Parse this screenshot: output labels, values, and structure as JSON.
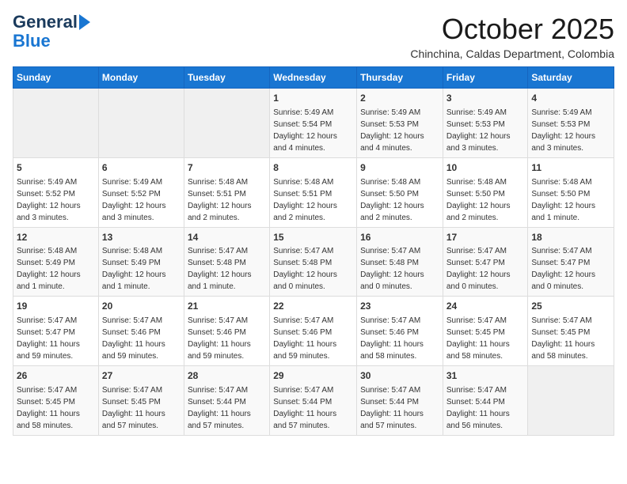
{
  "logo": {
    "line1": "General",
    "line2": "Blue"
  },
  "title": "October 2025",
  "location": "Chinchina, Caldas Department, Colombia",
  "days_of_week": [
    "Sunday",
    "Monday",
    "Tuesday",
    "Wednesday",
    "Thursday",
    "Friday",
    "Saturday"
  ],
  "weeks": [
    [
      {
        "day": "",
        "info": ""
      },
      {
        "day": "",
        "info": ""
      },
      {
        "day": "",
        "info": ""
      },
      {
        "day": "1",
        "info": "Sunrise: 5:49 AM\nSunset: 5:54 PM\nDaylight: 12 hours\nand 4 minutes."
      },
      {
        "day": "2",
        "info": "Sunrise: 5:49 AM\nSunset: 5:53 PM\nDaylight: 12 hours\nand 4 minutes."
      },
      {
        "day": "3",
        "info": "Sunrise: 5:49 AM\nSunset: 5:53 PM\nDaylight: 12 hours\nand 3 minutes."
      },
      {
        "day": "4",
        "info": "Sunrise: 5:49 AM\nSunset: 5:53 PM\nDaylight: 12 hours\nand 3 minutes."
      }
    ],
    [
      {
        "day": "5",
        "info": "Sunrise: 5:49 AM\nSunset: 5:52 PM\nDaylight: 12 hours\nand 3 minutes."
      },
      {
        "day": "6",
        "info": "Sunrise: 5:49 AM\nSunset: 5:52 PM\nDaylight: 12 hours\nand 3 minutes."
      },
      {
        "day": "7",
        "info": "Sunrise: 5:48 AM\nSunset: 5:51 PM\nDaylight: 12 hours\nand 2 minutes."
      },
      {
        "day": "8",
        "info": "Sunrise: 5:48 AM\nSunset: 5:51 PM\nDaylight: 12 hours\nand 2 minutes."
      },
      {
        "day": "9",
        "info": "Sunrise: 5:48 AM\nSunset: 5:50 PM\nDaylight: 12 hours\nand 2 minutes."
      },
      {
        "day": "10",
        "info": "Sunrise: 5:48 AM\nSunset: 5:50 PM\nDaylight: 12 hours\nand 2 minutes."
      },
      {
        "day": "11",
        "info": "Sunrise: 5:48 AM\nSunset: 5:50 PM\nDaylight: 12 hours\nand 1 minute."
      }
    ],
    [
      {
        "day": "12",
        "info": "Sunrise: 5:48 AM\nSunset: 5:49 PM\nDaylight: 12 hours\nand 1 minute."
      },
      {
        "day": "13",
        "info": "Sunrise: 5:48 AM\nSunset: 5:49 PM\nDaylight: 12 hours\nand 1 minute."
      },
      {
        "day": "14",
        "info": "Sunrise: 5:47 AM\nSunset: 5:48 PM\nDaylight: 12 hours\nand 1 minute."
      },
      {
        "day": "15",
        "info": "Sunrise: 5:47 AM\nSunset: 5:48 PM\nDaylight: 12 hours\nand 0 minutes."
      },
      {
        "day": "16",
        "info": "Sunrise: 5:47 AM\nSunset: 5:48 PM\nDaylight: 12 hours\nand 0 minutes."
      },
      {
        "day": "17",
        "info": "Sunrise: 5:47 AM\nSunset: 5:47 PM\nDaylight: 12 hours\nand 0 minutes."
      },
      {
        "day": "18",
        "info": "Sunrise: 5:47 AM\nSunset: 5:47 PM\nDaylight: 12 hours\nand 0 minutes."
      }
    ],
    [
      {
        "day": "19",
        "info": "Sunrise: 5:47 AM\nSunset: 5:47 PM\nDaylight: 11 hours\nand 59 minutes."
      },
      {
        "day": "20",
        "info": "Sunrise: 5:47 AM\nSunset: 5:46 PM\nDaylight: 11 hours\nand 59 minutes."
      },
      {
        "day": "21",
        "info": "Sunrise: 5:47 AM\nSunset: 5:46 PM\nDaylight: 11 hours\nand 59 minutes."
      },
      {
        "day": "22",
        "info": "Sunrise: 5:47 AM\nSunset: 5:46 PM\nDaylight: 11 hours\nand 59 minutes."
      },
      {
        "day": "23",
        "info": "Sunrise: 5:47 AM\nSunset: 5:46 PM\nDaylight: 11 hours\nand 58 minutes."
      },
      {
        "day": "24",
        "info": "Sunrise: 5:47 AM\nSunset: 5:45 PM\nDaylight: 11 hours\nand 58 minutes."
      },
      {
        "day": "25",
        "info": "Sunrise: 5:47 AM\nSunset: 5:45 PM\nDaylight: 11 hours\nand 58 minutes."
      }
    ],
    [
      {
        "day": "26",
        "info": "Sunrise: 5:47 AM\nSunset: 5:45 PM\nDaylight: 11 hours\nand 58 minutes."
      },
      {
        "day": "27",
        "info": "Sunrise: 5:47 AM\nSunset: 5:45 PM\nDaylight: 11 hours\nand 57 minutes."
      },
      {
        "day": "28",
        "info": "Sunrise: 5:47 AM\nSunset: 5:44 PM\nDaylight: 11 hours\nand 57 minutes."
      },
      {
        "day": "29",
        "info": "Sunrise: 5:47 AM\nSunset: 5:44 PM\nDaylight: 11 hours\nand 57 minutes."
      },
      {
        "day": "30",
        "info": "Sunrise: 5:47 AM\nSunset: 5:44 PM\nDaylight: 11 hours\nand 57 minutes."
      },
      {
        "day": "31",
        "info": "Sunrise: 5:47 AM\nSunset: 5:44 PM\nDaylight: 11 hours\nand 56 minutes."
      },
      {
        "day": "",
        "info": ""
      }
    ]
  ]
}
